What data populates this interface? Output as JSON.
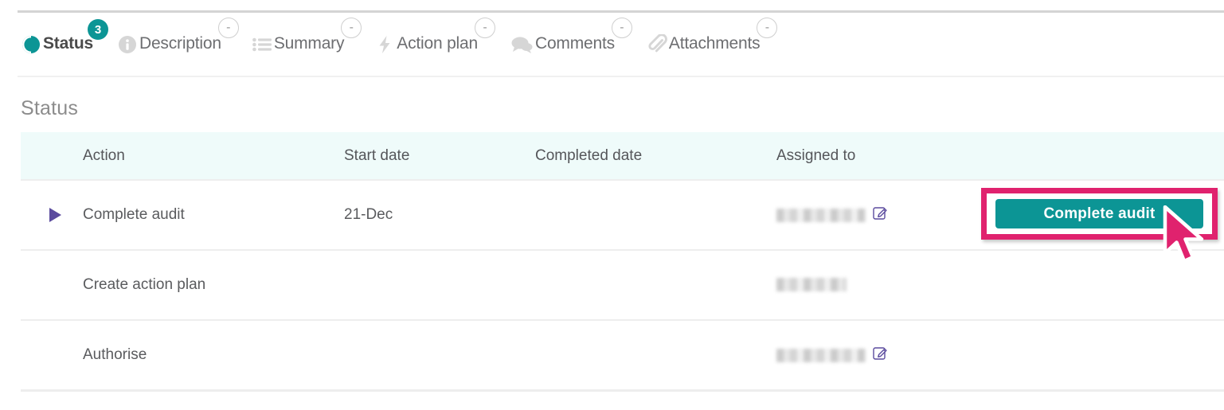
{
  "colors": {
    "accent_teal": "#0c9595",
    "highlight_pink": "#e0226e",
    "caret_purple": "#5b4b9e",
    "header_row_bg": "#effbfa",
    "text_gray": "#5a5b5e"
  },
  "tabs": [
    {
      "label": "Status",
      "icon": "contrast-circle-icon",
      "badge": "3",
      "active": true,
      "badge_muted": false
    },
    {
      "label": "Description",
      "icon": "info-circle-icon",
      "badge": "-",
      "active": false,
      "badge_muted": true
    },
    {
      "label": "Summary",
      "icon": "list-bullets-icon",
      "badge": "-",
      "active": false,
      "badge_muted": true
    },
    {
      "label": "Action plan",
      "icon": "lightning-bolt-icon",
      "badge": "-",
      "active": false,
      "badge_muted": true
    },
    {
      "label": "Comments",
      "icon": "speech-bubbles-icon",
      "badge": "-",
      "active": false,
      "badge_muted": true
    },
    {
      "label": "Attachments",
      "icon": "paperclip-icon",
      "badge": "-",
      "active": false,
      "badge_muted": true
    }
  ],
  "section": {
    "title": "Status"
  },
  "table": {
    "columns": [
      "",
      "Action",
      "Start date",
      "Completed date",
      "Assigned to",
      ""
    ],
    "rows": [
      {
        "caret": true,
        "action": "Complete audit",
        "start_date": "21-Dec",
        "completed_date": "",
        "assigned_to_redacted": true,
        "assigned_blur_width": "w3",
        "has_edit_icon": true,
        "button_label": "Complete audit"
      },
      {
        "caret": false,
        "action": "Create action plan",
        "start_date": "",
        "completed_date": "",
        "assigned_to_redacted": true,
        "assigned_blur_width": "w2",
        "has_edit_icon": false,
        "button_label": ""
      },
      {
        "caret": false,
        "action": "Authorise",
        "start_date": "",
        "completed_date": "",
        "assigned_to_redacted": true,
        "assigned_blur_width": "w3",
        "has_edit_icon": true,
        "button_label": ""
      }
    ]
  },
  "action_button": {
    "label": "Complete audit"
  }
}
